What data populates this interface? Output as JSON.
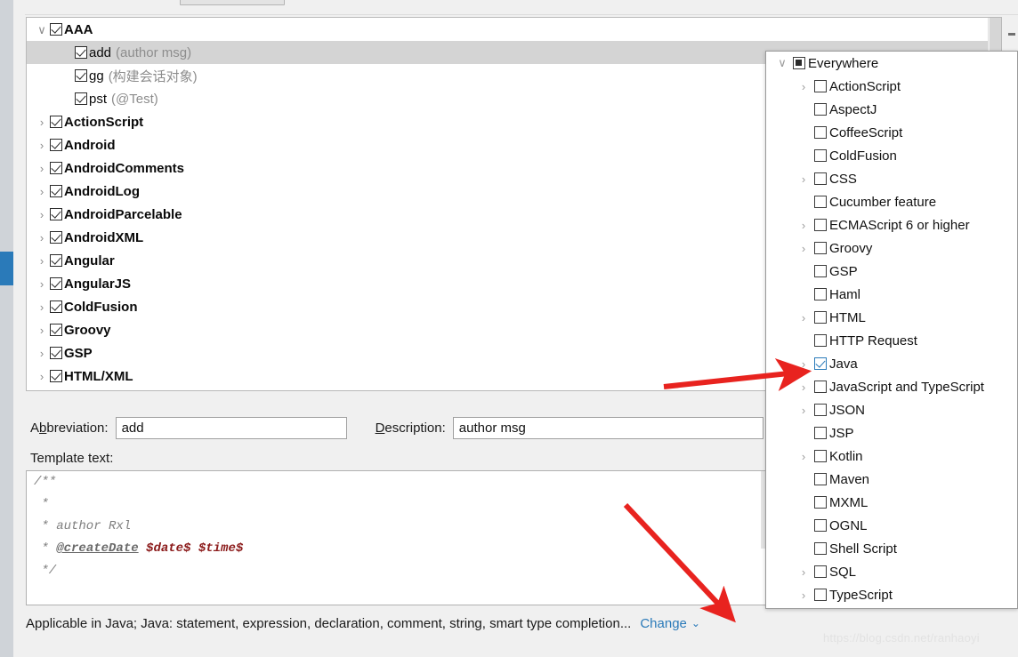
{
  "window": {
    "watermark": "https://blog.csdn.net/ranhaoyi"
  },
  "templates_tree": {
    "rows": [
      {
        "twisty": "∨",
        "checked": true,
        "bold": true,
        "indent": 0,
        "label": "AAA",
        "desc": "",
        "selected": false
      },
      {
        "twisty": "",
        "checked": true,
        "bold": false,
        "indent": 1,
        "label": "add",
        "desc": "(author msg)",
        "selected": true
      },
      {
        "twisty": "",
        "checked": true,
        "bold": false,
        "indent": 1,
        "label": "gg",
        "desc": "(构建会话对象)",
        "selected": false
      },
      {
        "twisty": "",
        "checked": true,
        "bold": false,
        "indent": 1,
        "label": "pst",
        "desc": "(@Test)",
        "selected": false
      },
      {
        "twisty": "›",
        "checked": true,
        "bold": true,
        "indent": 0,
        "label": "ActionScript",
        "desc": "",
        "selected": false
      },
      {
        "twisty": "›",
        "checked": true,
        "bold": true,
        "indent": 0,
        "label": "Android",
        "desc": "",
        "selected": false
      },
      {
        "twisty": "›",
        "checked": true,
        "bold": true,
        "indent": 0,
        "label": "AndroidComments",
        "desc": "",
        "selected": false
      },
      {
        "twisty": "›",
        "checked": true,
        "bold": true,
        "indent": 0,
        "label": "AndroidLog",
        "desc": "",
        "selected": false
      },
      {
        "twisty": "›",
        "checked": true,
        "bold": true,
        "indent": 0,
        "label": "AndroidParcelable",
        "desc": "",
        "selected": false
      },
      {
        "twisty": "›",
        "checked": true,
        "bold": true,
        "indent": 0,
        "label": "AndroidXML",
        "desc": "",
        "selected": false
      },
      {
        "twisty": "›",
        "checked": true,
        "bold": true,
        "indent": 0,
        "label": "Angular",
        "desc": "",
        "selected": false
      },
      {
        "twisty": "›",
        "checked": true,
        "bold": true,
        "indent": 0,
        "label": "AngularJS",
        "desc": "",
        "selected": false
      },
      {
        "twisty": "›",
        "checked": true,
        "bold": true,
        "indent": 0,
        "label": "ColdFusion",
        "desc": "",
        "selected": false
      },
      {
        "twisty": "›",
        "checked": true,
        "bold": true,
        "indent": 0,
        "label": "Groovy",
        "desc": "",
        "selected": false
      },
      {
        "twisty": "›",
        "checked": true,
        "bold": true,
        "indent": 0,
        "label": "GSP",
        "desc": "",
        "selected": false
      },
      {
        "twisty": "›",
        "checked": true,
        "bold": true,
        "indent": 0,
        "label": "HTML/XML",
        "desc": "",
        "selected": false
      }
    ]
  },
  "form": {
    "abbreviation_label": "Abbreviation:",
    "abbreviation_label_pre": "A",
    "abbreviation_label_mnemonic": "b",
    "abbreviation_label_post": "breviation:",
    "abbreviation_value": "add",
    "description_label_mnemonic": "D",
    "description_label_post": "escription:",
    "description_value": "author msg",
    "template_text_label_mnemonic": "T",
    "template_text_label_post": "emplate text:"
  },
  "editor": {
    "lines": [
      {
        "plain": "/**"
      },
      {
        "plain": " *"
      },
      {
        "plain": " * author Rxl"
      },
      {
        "prefix": " * ",
        "tag": "@createDate",
        "vars": " $date$ $time$"
      },
      {
        "plain": " */"
      }
    ]
  },
  "status": {
    "text": "Applicable in Java; Java: statement, expression, declaration, comment, string, smart type completion...",
    "change_label": "Change",
    "change_caret": "⌄"
  },
  "contexts_popup": {
    "rows": [
      {
        "twisty": "∨",
        "state": "partial",
        "indent": 0,
        "label": "Everywhere"
      },
      {
        "twisty": "›",
        "state": "unchecked",
        "indent": 1,
        "label": "ActionScript"
      },
      {
        "twisty": "",
        "state": "unchecked",
        "indent": 1,
        "label": "AspectJ"
      },
      {
        "twisty": "",
        "state": "unchecked",
        "indent": 1,
        "label": "CoffeeScript"
      },
      {
        "twisty": "",
        "state": "unchecked",
        "indent": 1,
        "label": "ColdFusion"
      },
      {
        "twisty": "›",
        "state": "unchecked",
        "indent": 1,
        "label": "CSS"
      },
      {
        "twisty": "",
        "state": "unchecked",
        "indent": 1,
        "label": "Cucumber feature"
      },
      {
        "twisty": "›",
        "state": "unchecked",
        "indent": 1,
        "label": "ECMAScript 6 or higher"
      },
      {
        "twisty": "›",
        "state": "unchecked",
        "indent": 1,
        "label": "Groovy"
      },
      {
        "twisty": "",
        "state": "unchecked",
        "indent": 1,
        "label": "GSP"
      },
      {
        "twisty": "",
        "state": "unchecked",
        "indent": 1,
        "label": "Haml"
      },
      {
        "twisty": "›",
        "state": "unchecked",
        "indent": 1,
        "label": "HTML"
      },
      {
        "twisty": "",
        "state": "unchecked",
        "indent": 1,
        "label": "HTTP Request"
      },
      {
        "twisty": "›",
        "state": "checked",
        "indent": 1,
        "label": "Java"
      },
      {
        "twisty": "›",
        "state": "unchecked",
        "indent": 1,
        "label": "JavaScript and TypeScript"
      },
      {
        "twisty": "›",
        "state": "unchecked",
        "indent": 1,
        "label": "JSON"
      },
      {
        "twisty": "",
        "state": "unchecked",
        "indent": 1,
        "label": "JSP"
      },
      {
        "twisty": "›",
        "state": "unchecked",
        "indent": 1,
        "label": "Kotlin"
      },
      {
        "twisty": "",
        "state": "unchecked",
        "indent": 1,
        "label": "Maven"
      },
      {
        "twisty": "",
        "state": "unchecked",
        "indent": 1,
        "label": "MXML"
      },
      {
        "twisty": "",
        "state": "unchecked",
        "indent": 1,
        "label": "OGNL"
      },
      {
        "twisty": "",
        "state": "unchecked",
        "indent": 1,
        "label": "Shell Script"
      },
      {
        "twisty": "›",
        "state": "unchecked",
        "indent": 1,
        "label": "SQL"
      },
      {
        "twisty": "›",
        "state": "unchecked",
        "indent": 1,
        "label": "TypeScript"
      }
    ]
  },
  "colors": {
    "accent": "#2a7ab9",
    "annotation": "#e8231f",
    "selection": "#d4d4d4"
  }
}
